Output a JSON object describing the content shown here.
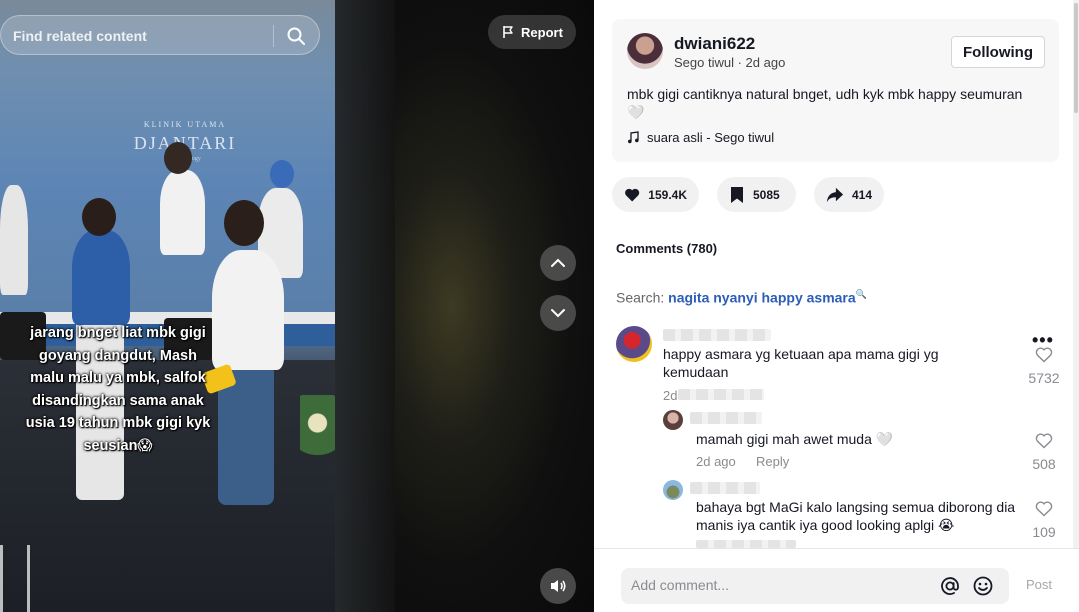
{
  "video": {
    "search_placeholder": "Find related content",
    "report_label": "Report",
    "caption": "jarang bnget liat mbk gigi goyang dangdut, Mash malu malu ya mbk, salfok disandingkan sama anak usia 19 tahun mbk gigi kyk seusian😱",
    "backdrop_small": "KLINIK UTAMA",
    "backdrop_big": "DJANTARI",
    "backdrop_sub": "Dermatology"
  },
  "author": {
    "username": "dwiani622",
    "subline": "Sego tiwul · 2d ago",
    "follow_label": "Following",
    "description": "mbk gigi cantiknya natural bnget, udh kyk mbk happy seumuran 🤍",
    "music": "suara asli - Sego tiwul"
  },
  "actions": {
    "likes": "159.4K",
    "saves": "5085",
    "shares": "414"
  },
  "comments": {
    "title": "Comments (780)",
    "search_prefix": "Search: ",
    "search_query": "nagita nyanyi happy asmara",
    "items": [
      {
        "text": "happy asmara yg ketuaan apa mama gigi yg kemudaan",
        "meta": "2d",
        "likes": "5732"
      },
      {
        "text": "mamah gigi mah awet muda 🤍",
        "meta": "2d ago",
        "reply": "Reply",
        "likes": "508"
      },
      {
        "text": "bahaya bgt MaGi kalo langsing semua diborong dia manis iya cantik iya good looking aplgi 😭",
        "likes": "109"
      }
    ],
    "more": "•••"
  },
  "input": {
    "placeholder": "Add comment...",
    "post_label": "Post"
  }
}
